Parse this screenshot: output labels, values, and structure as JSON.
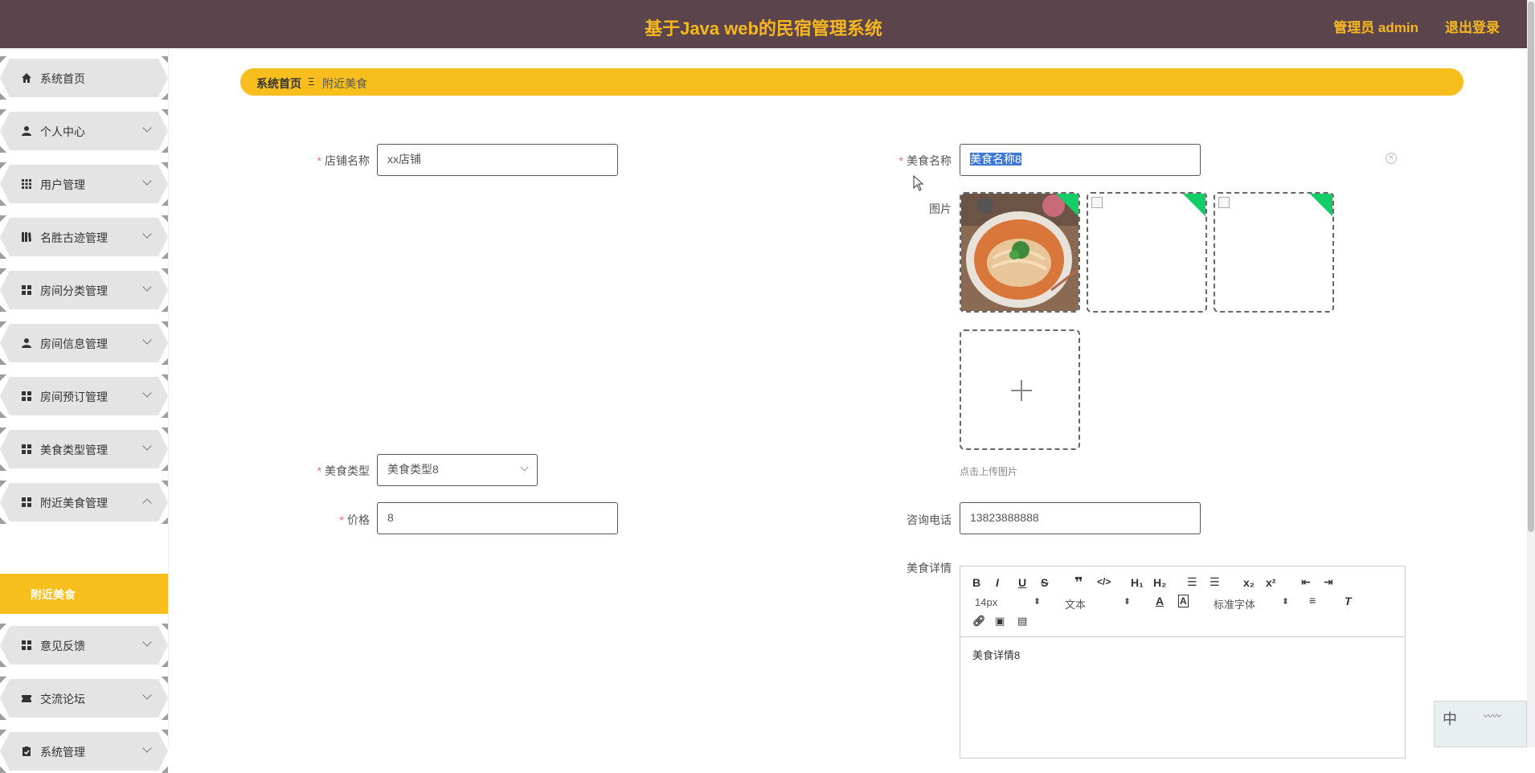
{
  "header": {
    "title": "基于Java web的民宿管理系统",
    "admin": "管理员 admin",
    "logout": "退出登录"
  },
  "sidebar": {
    "items": [
      {
        "label": "系统首页",
        "icon": "home-icon"
      },
      {
        "label": "个人中心",
        "icon": "person-icon"
      },
      {
        "label": "用户管理",
        "icon": "grid-icon"
      },
      {
        "label": "名胜古迹管理",
        "icon": "book-icon"
      },
      {
        "label": "房间分类管理",
        "icon": "grid-icon"
      },
      {
        "label": "房间信息管理",
        "icon": "person-icon"
      },
      {
        "label": "房间预订管理",
        "icon": "grid-icon"
      },
      {
        "label": "美食类型管理",
        "icon": "grid-icon"
      },
      {
        "label": "附近美食管理",
        "icon": "grid-icon"
      },
      {
        "label": "意见反馈",
        "icon": "grid-icon"
      },
      {
        "label": "交流论坛",
        "icon": "ticket-icon"
      },
      {
        "label": "系统管理",
        "icon": "clipboard-icon"
      }
    ],
    "active_sub": "附近美食",
    "accent": "#f7be1d"
  },
  "breadcrumb": {
    "home": "系统首页",
    "separator": "Ξ",
    "current": "附近美食"
  },
  "form": {
    "shop_name": {
      "label": "店铺名称",
      "value": "xx店铺"
    },
    "food_name": {
      "label": "美食名称",
      "value": "美食名称8"
    },
    "picture": {
      "label": "图片",
      "hint": "点击上传图片"
    },
    "food_type": {
      "label": "美食类型",
      "value": "美食类型8"
    },
    "price": {
      "label": "价格",
      "value": "8"
    },
    "phone": {
      "label": "咨询电话",
      "value": "13823888888"
    },
    "details": {
      "label": "美食详情",
      "content": "美食详情8"
    }
  },
  "editor": {
    "font_size": "14px",
    "heading": "文本",
    "font_family": "标准字体"
  },
  "ime": {
    "mode": "中"
  }
}
